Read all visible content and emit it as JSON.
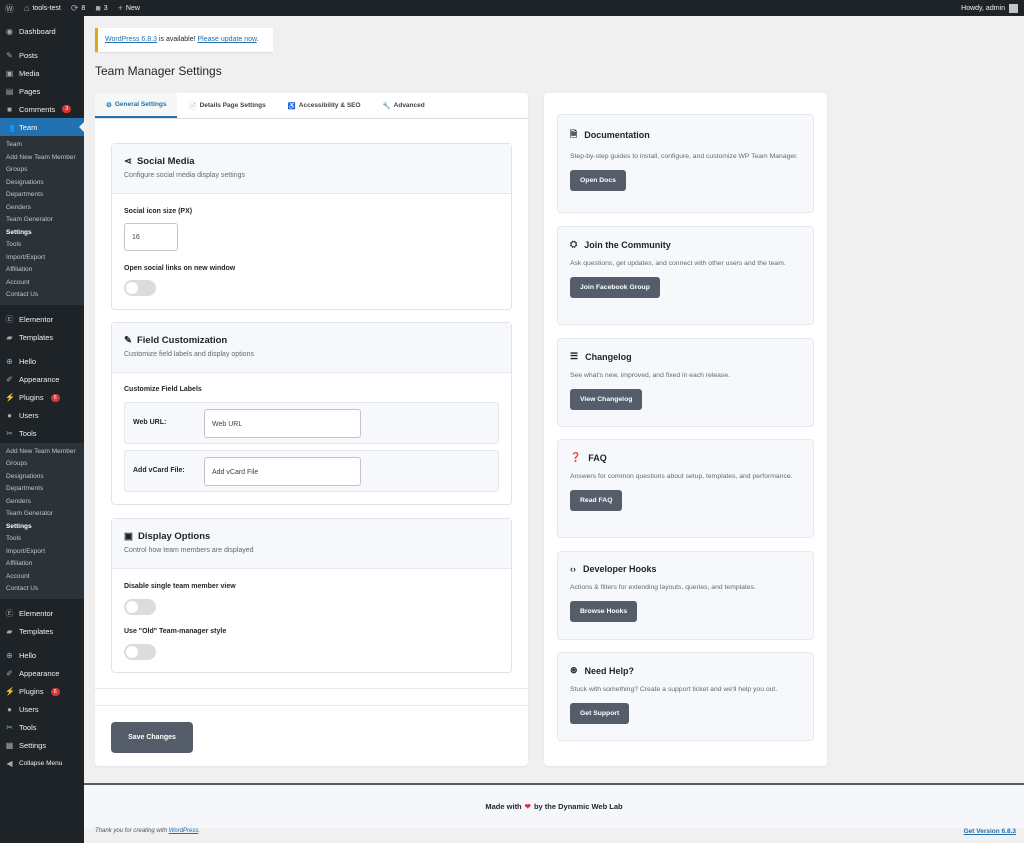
{
  "adminbar": {
    "site": "tools-test",
    "updates": "8",
    "comments": "3",
    "new": "New",
    "howdy": "Howdy, admin"
  },
  "sidebar": {
    "dashboard": "Dashboard",
    "posts": "Posts",
    "media": "Media",
    "pages": "Pages",
    "comments": "Comments",
    "comments_badge": "3",
    "team": "Team",
    "team_sub": [
      "Team",
      "Add New Team Member",
      "Groups",
      "Designations",
      "Departments",
      "Genders",
      "Team Generator",
      "Settings",
      "Tools",
      "Import/Export",
      "Affiliation",
      "Account",
      "Contact Us"
    ],
    "elementor": "Elementor",
    "templates": "Templates",
    "hello": "Hello",
    "appearance": "Appearance",
    "plugins": "Plugins",
    "plugins_badge": "6",
    "users": "Users",
    "tools": "Tools",
    "tools_sub": [
      "Add New Team Member",
      "Groups",
      "Designations",
      "Departments",
      "Genders",
      "Team Generator",
      "Settings",
      "Tools",
      "Import/Export",
      "Affiliation",
      "Account",
      "Contact Us"
    ],
    "settings": "Settings",
    "collapse": "Collapse Menu"
  },
  "notice": {
    "link1": "WordPress 6.8.3",
    "text": " is available! ",
    "link2": "Please update now",
    "end": "."
  },
  "page_title": "Team Manager Settings",
  "tabs": [
    {
      "icon": "⚙",
      "label": "General Settings"
    },
    {
      "icon": "📄",
      "label": "Details Page Settings"
    },
    {
      "icon": "♿",
      "label": "Accessibility & SEO"
    },
    {
      "icon": "🔧",
      "label": "Advanced"
    }
  ],
  "social": {
    "title": "Social Media",
    "desc": "Configure social media display settings",
    "icon_size_label": "Social icon size (PX)",
    "icon_size_value": "16",
    "new_window_label": "Open social links on new window"
  },
  "fields": {
    "title": "Field Customization",
    "desc": "Customize field labels and display options",
    "heading": "Customize Field Labels",
    "rows": [
      {
        "label": "Web URL:",
        "value": "Web URL"
      },
      {
        "label": "Add vCard File:",
        "value": "Add vCard File"
      }
    ]
  },
  "display": {
    "title": "Display Options",
    "desc": "Control how team members are displayed",
    "opt1": "Disable single team member view",
    "opt2": "Use \"Old\" Team-manager style"
  },
  "save_label": "Save Changes",
  "resources": [
    {
      "title": "Documentation",
      "desc": "Step-by-step guides to install, configure, and customize WP Team Manager.",
      "button": "Open Docs"
    },
    {
      "title": "Join the Community",
      "desc": "Ask questions, get updates, and connect with other users and the team.",
      "button": "Join Facebook Group"
    },
    {
      "title": "Changelog",
      "desc": "See what's new, improved, and fixed in each release.",
      "button": "View Changelog"
    },
    {
      "title": "FAQ",
      "desc": "Answers for common questions about setup, templates, and performance.",
      "button": "Read FAQ"
    },
    {
      "title": "Developer Hooks",
      "desc": "Actions & filters for extending layouts, queries, and templates.",
      "button": "Browse Hooks"
    },
    {
      "title": "Need Help?",
      "desc": "Stuck with something? Create a support ticket and we'll help you out.",
      "button": "Get Support"
    }
  ],
  "footer": {
    "made_with": "Made with",
    "by": "by the Dynamic Web Lab",
    "thanks": "Thank you for creating with ",
    "wp": "WordPress",
    "thanks_end": ".",
    "version": "Get Version 6.8.3"
  }
}
